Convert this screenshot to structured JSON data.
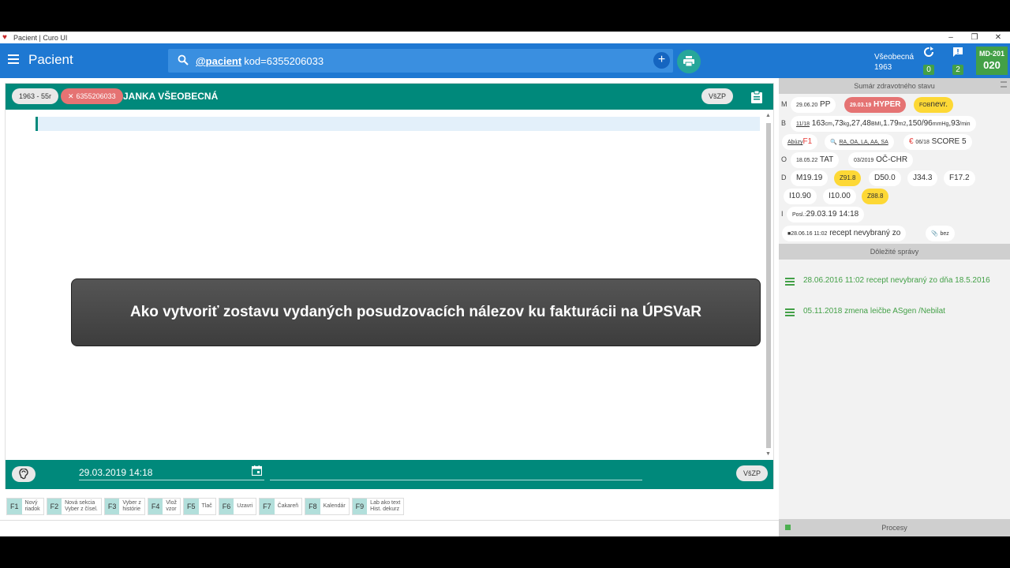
{
  "window": {
    "title": "Pacient | Curo UI"
  },
  "header": {
    "title": "Pacient",
    "search_keyword": "@pacient",
    "search_query": "kod=6355206033",
    "doctor_name": "Všeobecná",
    "doctor_year": "1963",
    "sync_count": "0",
    "message_count": "2",
    "md_code": "MD-201",
    "md_number": "020"
  },
  "patient": {
    "age_chip": "1963 - 55r",
    "id_chip": "6355206033",
    "name": "JANKA VŠEOBECNÁ",
    "insurer": "VšZP"
  },
  "overlay": {
    "text": "Ako vytvoriť zostavu vydaných posudzovacích nálezov ku fakturácii na ÚPSVaR"
  },
  "bottom": {
    "date": "29.03.2019 14:18",
    "insurer": "VšZP"
  },
  "fkeys": [
    {
      "key": "F1",
      "l1": "Nový",
      "l2": "riadok"
    },
    {
      "key": "F2",
      "l1": "Nová sekcia",
      "l2": "Vyber z čísel."
    },
    {
      "key": "F3",
      "l1": "Vyber z",
      "l2": "histórie"
    },
    {
      "key": "F4",
      "l1": "Vlož",
      "l2": "vzor"
    },
    {
      "key": "F5",
      "l1": "Tlač",
      "l2": ""
    },
    {
      "key": "F6",
      "l1": "Uzavri",
      "l2": ""
    },
    {
      "key": "F7",
      "l1": "Čakareň",
      "l2": ""
    },
    {
      "key": "F8",
      "l1": "Kalendár",
      "l2": ""
    },
    {
      "key": "F9",
      "l1": "Lab ako text",
      "l2": "Hist. dekurz"
    }
  ],
  "summary": {
    "title": "Sumár zdravotného stavu",
    "letters": [
      "M",
      "B",
      "O",
      "D",
      "I"
    ],
    "m_date": "29.06.20",
    "m_pp": "PP",
    "m_hyper_date": "29.03.19",
    "m_hyper": "HYPER",
    "m_fob": "FOB",
    "m_fob_val": "nevr.",
    "b_date": "11/18",
    "b_height": "163",
    "b_height_u": "cm",
    "b_weight": "73",
    "b_weight_u": "kg",
    "b_bmi": "27,48",
    "b_bmi_u": "BMI",
    "b_bsa": "1.79",
    "b_bsa_u": "m2",
    "b_bp": "150/96",
    "b_bp_u": "mmHg",
    "b_hr": "93",
    "b_hr_u": "/min",
    "abuzy": "Abúzy",
    "abuzy_val": "F1",
    "allergy": "RA, OA, LA, AA, SA",
    "score_date": "06/18",
    "score": "SCORE 5",
    "o_date": "18.05.22",
    "o_tat": "TAT",
    "o_date2": "03/2019",
    "o_chr": "OČ-CHR",
    "d_codes": [
      "M19.19",
      "Z91.8",
      "D50.0",
      "J34.3",
      "F17.2",
      "I10.90",
      "I10.00",
      "Z88.8"
    ],
    "i_label": "Posl.:",
    "i_last": "29.03.19 14:18",
    "note_date": "28.06.16 11:02",
    "note_text": "recept nevybraný zo",
    "attach": "bez"
  },
  "messages": {
    "title": "Dôležité správy",
    "items": [
      {
        "text": "28.06.2016 11:02 recept nevybraný zo dňa 18.5.2016"
      },
      {
        "text": "05.11.2018 zmena leičbe ASgen /Nebilat"
      }
    ]
  },
  "procesy": {
    "title": "Procesy"
  },
  "colors": {
    "header": "#1e78d2",
    "teal": "#00897b",
    "red": "#e57373",
    "yellow": "#fdd835",
    "green": "#43a047"
  }
}
